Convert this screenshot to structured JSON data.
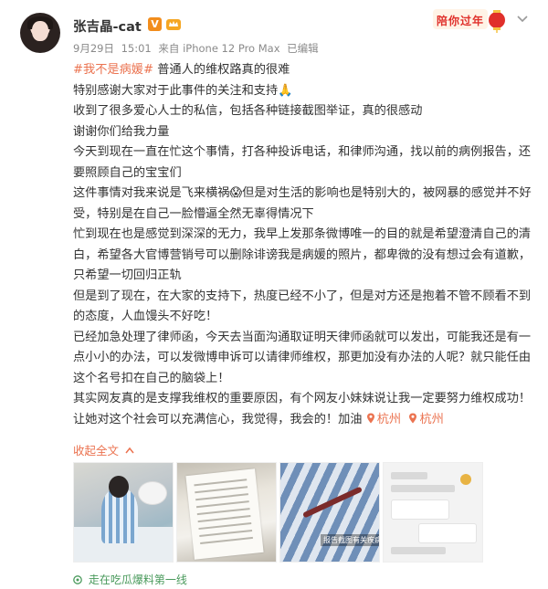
{
  "user": {
    "name": "张吉晶-cat",
    "verified_mark": "V"
  },
  "meta": {
    "date": "9月29日",
    "time": "15:01",
    "source": "来自 iPhone 12 Pro Max",
    "edited": "已编辑"
  },
  "promo": {
    "text": "陪你过年"
  },
  "post": {
    "lines": [
      {
        "hashtag": "#我不是病媛#",
        "text": " 普通人的维权路真的很难"
      },
      {
        "text": "特别感谢大家对于此事件的关注和支持🙏"
      },
      {
        "text": "收到了很多爱心人士的私信，包括各种链接截图举证，真的很感动"
      },
      {
        "text": "谢谢你们给我力量"
      },
      {
        "text": "今天到现在一直在忙这个事情，打各种投诉电话，和律师沟通，找以前的病例报告，还要照顾自己的宝宝们"
      },
      {
        "text": "这件事情对我来说是飞来横祸😱但是对生活的影响也是特别大的，被网暴的感觉并不好受，特别是在自己一脸懵逼全然无辜得情况下"
      },
      {
        "text": "忙到现在也是感觉到深深的无力，我早上发那条微博唯一的目的就是希望澄清自己的清白，希望各大官博营销号可以删除诽谤我是病媛的照片，都卑微的没有想过会有道歉，只希望一切回归正轨"
      },
      {
        "text": "但是到了现在，在大家的支持下，热度已经不小了，但是对方还是抱着不管不顾看不到的态度，人血馒头不好吃！"
      },
      {
        "text": "已经加急处理了律师函，今天去当面沟通取证明天律师函就可以发出，可能我还是有一点小小的办法，可以发微博申诉可以请律师维权，那更加没有办法的人呢？就只能任由这个名号扣在自己的脑袋上！"
      },
      {
        "text": "其实网友真的是支撑我维权的重要原因，有个网友小妹妹说让我一定要努力维权成功！让她对这个社会可以充满信心，我觉得，我会的！加油 "
      }
    ],
    "locations": [
      "杭州",
      "杭州"
    ],
    "collapse_label": "收起全文",
    "image_caption": "报告截图有关疾病"
  },
  "footer": {
    "text": "走在吃瓜爆料第一线"
  },
  "colors": {
    "accent": "#eb7350",
    "footer_green": "#4a9a5c",
    "meta_gray": "#8a8a8a"
  }
}
